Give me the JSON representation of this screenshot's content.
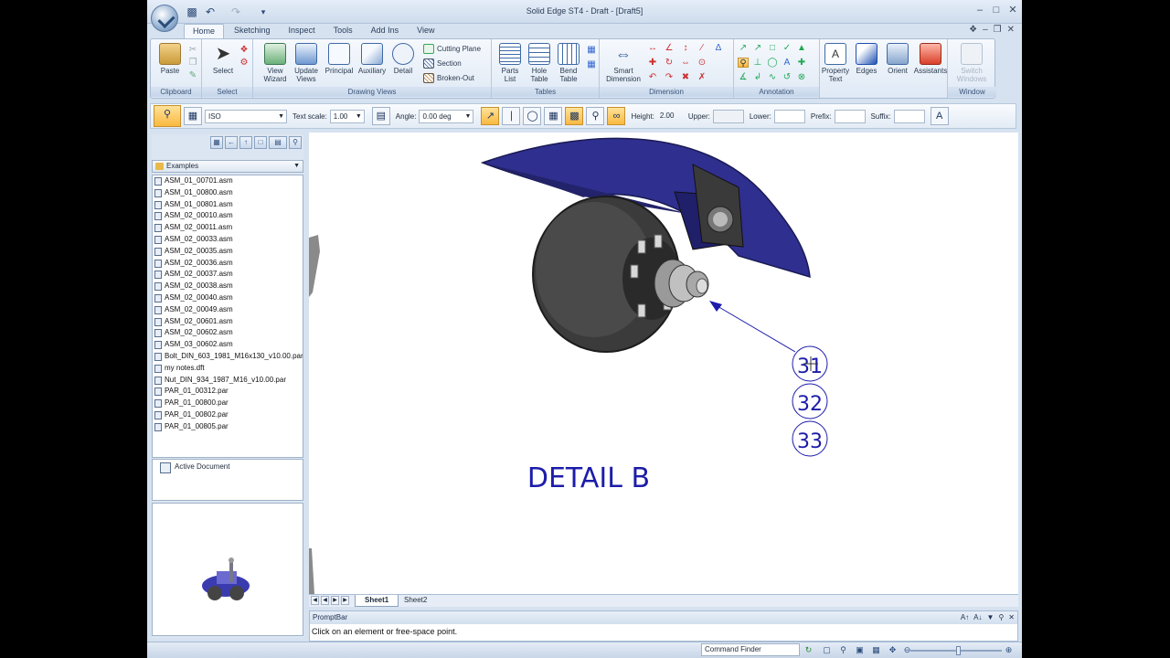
{
  "window": {
    "title": "Solid Edge ST4 - Draft - [Draft5]"
  },
  "tabs": [
    "Home",
    "Sketching",
    "Inspect",
    "Tools",
    "Add Ins",
    "View"
  ],
  "ribbon": {
    "clipboard": {
      "label": "Clipboard",
      "paste": "Paste"
    },
    "select": {
      "label": "Select",
      "select": "Select"
    },
    "drawing_views": {
      "label": "Drawing Views",
      "view_wizard": [
        "View",
        "Wizard"
      ],
      "update_views": [
        "Update",
        "Views"
      ],
      "principal": "Principal",
      "auxiliary": "Auxiliary",
      "detail": "Detail",
      "cutting_plane": "Cutting Plane",
      "section": "Section",
      "broken_out": "Broken-Out"
    },
    "tables": {
      "label": "Tables",
      "parts_list": [
        "Parts",
        "List"
      ],
      "hole_table": [
        "Hole",
        "Table"
      ],
      "bend_table": [
        "Bend",
        "Table"
      ]
    },
    "dimension": {
      "label": "Dimension",
      "smart_dimension": [
        "Smart",
        "Dimension"
      ]
    },
    "annotation": {
      "label": "Annotation",
      "property_text": [
        "Property",
        "Text"
      ]
    },
    "edges": "Edges",
    "orient": "Orient",
    "assistants": "Assistants",
    "window": {
      "label": "Window",
      "switch_windows": [
        "Switch",
        "Windows"
      ]
    }
  },
  "command_bar": {
    "standard": "ISO",
    "text_scale_label": "Text scale:",
    "text_scale": "1.00",
    "angle_label": "Angle:",
    "angle": "0.00 deg",
    "height_label": "Height:",
    "height": "2.00",
    "upper_label": "Upper:",
    "lower_label": "Lower:",
    "prefix_label": "Prefix:",
    "suffix_label": "Suffix:"
  },
  "library": {
    "folder": "Examples",
    "files": [
      "ASM_01_00701.asm",
      "ASM_01_00800.asm",
      "ASM_01_00801.asm",
      "ASM_02_00010.asm",
      "ASM_02_00011.asm",
      "ASM_02_00033.asm",
      "ASM_02_00035.asm",
      "ASM_02_00036.asm",
      "ASM_02_00037.asm",
      "ASM_02_00038.asm",
      "ASM_02_00040.asm",
      "ASM_02_00049.asm",
      "ASM_02_00601.asm",
      "ASM_02_00602.asm",
      "ASM_03_00602.asm",
      "Bolt_DIN_603_1981_M16x130_v10.00.par",
      "my notes.dft",
      "Nut_DIN_934_1987_M16_v10.00.par",
      "PAR_01_00312.par",
      "PAR_01_00800.par",
      "PAR_01_00802.par",
      "PAR_01_00805.par"
    ],
    "tree_node": "Active Document"
  },
  "drawing": {
    "detail_label": "DETAIL B",
    "balloons": [
      "31",
      "32",
      "33"
    ],
    "colors": {
      "fender": "#2f2f8f",
      "ink": "#1c1caa",
      "tire": "#3a3a3a"
    }
  },
  "sheets": [
    "Sheet1",
    "Sheet2"
  ],
  "promptbar": {
    "title": "PromptBar",
    "message": "Click on an element or free-space point."
  },
  "status": {
    "command_finder": "Command Finder"
  }
}
